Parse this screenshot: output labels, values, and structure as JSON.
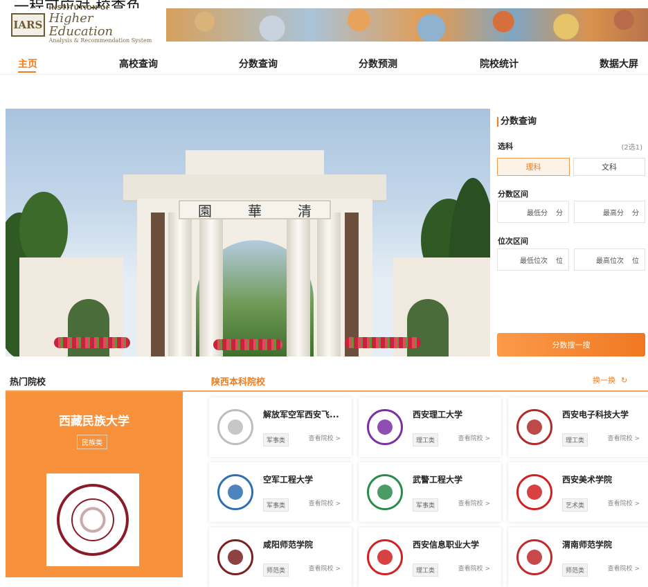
{
  "header": {
    "top_cut_text": "一程可应对-校查负",
    "logo": {
      "badge": "IARS",
      "line1": "INSTITUTION OF",
      "line2": "Higher Education",
      "line3": "Analysis & Recommendation System"
    }
  },
  "nav": {
    "items": [
      "主页",
      "高校查询",
      "分数查询",
      "分数预测",
      "院校统计",
      "数据大屏"
    ],
    "active_index": 0
  },
  "hero": {
    "sign_chars": [
      "園",
      "華",
      "清"
    ]
  },
  "query_panel": {
    "title": "分数查询",
    "subject_label": "选科",
    "subject_hint": "(2选1)",
    "subjects": [
      "理科",
      "文科"
    ],
    "selected_subject": "理科",
    "score_range_label": "分数区间",
    "score_min": "最低分",
    "score_max": "最高分",
    "score_unit": "分",
    "rank_range_label": "位次区间",
    "rank_min": "最低位次",
    "rank_max": "最高位次",
    "rank_unit": "位",
    "search_button": "分数搜一搜"
  },
  "hot": {
    "title": "热门院校",
    "featured": {
      "name": "西藏民族大学",
      "tag": "民族类"
    }
  },
  "shaanxi": {
    "title": "陕西本科院校",
    "switch_label": "换一换",
    "view_label": "查看院校 >",
    "universities": [
      {
        "name": "解放军空军西安飞...",
        "tag": "军事类",
        "logo_color": "#bdbdbd"
      },
      {
        "name": "西安理工大学",
        "tag": "理工类",
        "logo_color": "#7b2fa3"
      },
      {
        "name": "西安电子科技大学",
        "tag": "理工类",
        "logo_color": "#b02a2a"
      },
      {
        "name": "空军工程大学",
        "tag": "军事类",
        "logo_color": "#2e6fb0"
      },
      {
        "name": "武警工程大学",
        "tag": "军事类",
        "logo_color": "#2a8a4a"
      },
      {
        "name": "西安美术学院",
        "tag": "艺术类",
        "logo_color": "#d12020"
      },
      {
        "name": "咸阳师范学院",
        "tag": "师范类",
        "logo_color": "#7a2020"
      },
      {
        "name": "西安信息职业大学",
        "tag": "理工类",
        "logo_color": "#d12020"
      },
      {
        "name": "渭南师范学院",
        "tag": "师范类",
        "logo_color": "#c0282a"
      }
    ]
  },
  "colors": {
    "accent": "#f07c1e",
    "hot_card": "#f8913c"
  }
}
